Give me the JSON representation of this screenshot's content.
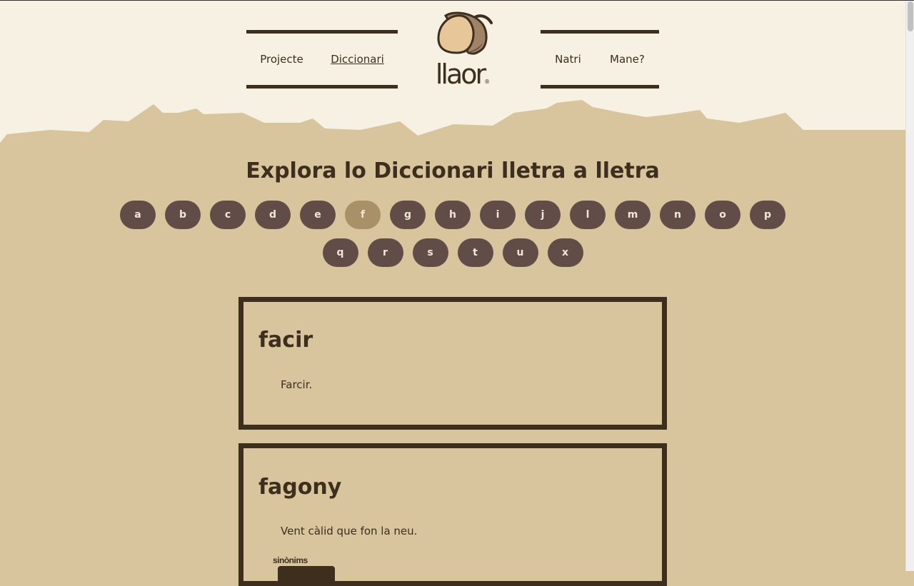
{
  "header": {
    "nav_left": [
      "Projecte",
      "Diccionari"
    ],
    "nav_right": [
      "Natri",
      "Mane?"
    ],
    "logo_text": "llaor",
    "logo_mark": "®"
  },
  "page_title": "Explora lo Diccionari lletra a lletra",
  "letters_row1": [
    "a",
    "b",
    "c",
    "d",
    "e",
    "f",
    "g",
    "h",
    "i",
    "j",
    "l",
    "m",
    "n",
    "o",
    "p"
  ],
  "letters_row2": [
    "q",
    "r",
    "s",
    "t",
    "u",
    "x"
  ],
  "active_letter": "f",
  "entries": [
    {
      "word": "facir",
      "definition": "Farcir."
    },
    {
      "word": "fagony",
      "definition": "Vent càlid que fon la neu.",
      "synonyms_label": "sinònims"
    }
  ],
  "colors": {
    "background": "#d8c49d",
    "header_bg": "#f6f1e2",
    "text": "#3d2e1e",
    "letter_button": "#614c48",
    "letter_button_active": "#a89068"
  }
}
